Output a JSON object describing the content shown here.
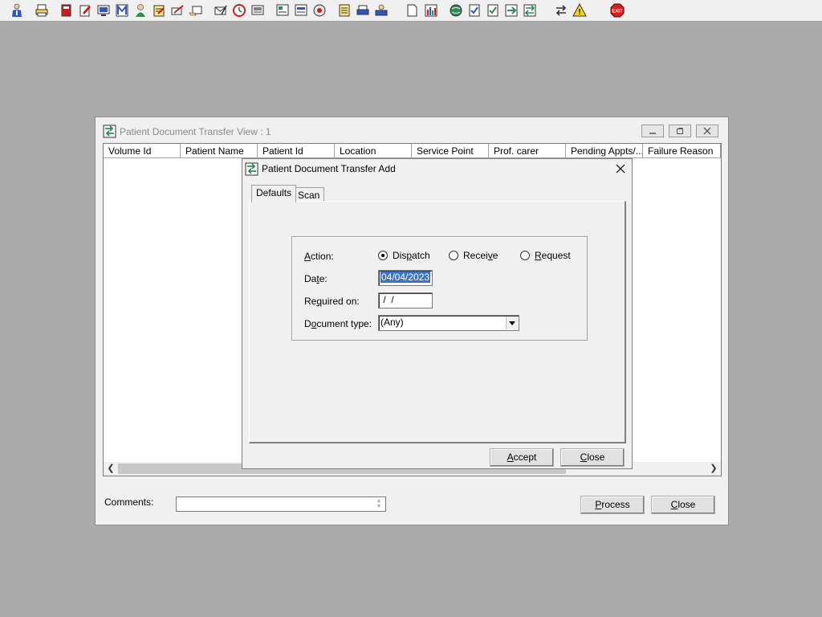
{
  "toolbar": {
    "icons": [
      "nurse-icon",
      "print-icon",
      "book-icon",
      "note-edit-icon",
      "monitor-icon",
      "mail-m-icon",
      "person-icon",
      "clipboard-icon",
      "hand-pen-icon",
      "hand-paper-icon",
      "envelope-pen-icon",
      "clock-icon",
      "screen-icon",
      "list-icon",
      "form-icon",
      "disc-icon",
      "notepad-icon",
      "printer-person-icon",
      "printer-doc-icon",
      "page-icon",
      "bar-chart-icon",
      "globe-icon",
      "clipboard-check-icon",
      "check-form-icon",
      "arrows-form-icon",
      "green-arrows-icon",
      "swap-arrows-icon",
      "warning-icon",
      "exit-icon"
    ],
    "exit_label": "EXIT",
    "warning_symbol": "!"
  },
  "main_window": {
    "title": "Patient Document Transfer View : 1",
    "columns": [
      "Volume Id",
      "Patient Name",
      "Patient Id",
      "Location",
      "Service Point",
      "Prof. carer",
      "Pending Appts/...",
      "Failure Reason"
    ],
    "comments_label": "Comments:",
    "comments_value": "",
    "process_button": {
      "prefix": "",
      "underlined": "P",
      "rest": "rocess"
    },
    "close_button": {
      "prefix": "",
      "underlined": "C",
      "rest": "lose"
    }
  },
  "dialog": {
    "title": "Patient Document Transfer Add",
    "tabs": [
      {
        "label": "Defaults",
        "active": true
      },
      {
        "label": "Scan",
        "active": false
      }
    ],
    "action_label": {
      "prefix": "",
      "underlined": "A",
      "rest": "ction:"
    },
    "action_options": [
      {
        "prefix": "Dis",
        "underlined": "p",
        "rest": "atch",
        "checked": true
      },
      {
        "prefix": "Recei",
        "underlined": "v",
        "rest": "e",
        "checked": false
      },
      {
        "prefix": "",
        "underlined": "R",
        "rest": "equest",
        "checked": false
      }
    ],
    "date_label": {
      "prefix": "Da",
      "underlined": "t",
      "rest": "e:"
    },
    "date_value": "04/04/2023",
    "required_label": {
      "prefix": "Re",
      "underlined": "q",
      "rest": "uired on:"
    },
    "required_value": " /  /",
    "doctype_label": {
      "prefix": "D",
      "underlined": "o",
      "rest": "cument type:"
    },
    "doctype_value": "(Any)",
    "accept_button": {
      "prefix": "",
      "underlined": "A",
      "rest": "ccept"
    },
    "close_button": {
      "prefix": "",
      "underlined": "C",
      "rest": "lose"
    }
  },
  "colors": {
    "desktop": "#ababab",
    "dialog_border": "#3f8fd2",
    "selection": "#3a72c6",
    "exit_red": "#d42020",
    "warning_yellow": "#f7d417"
  }
}
